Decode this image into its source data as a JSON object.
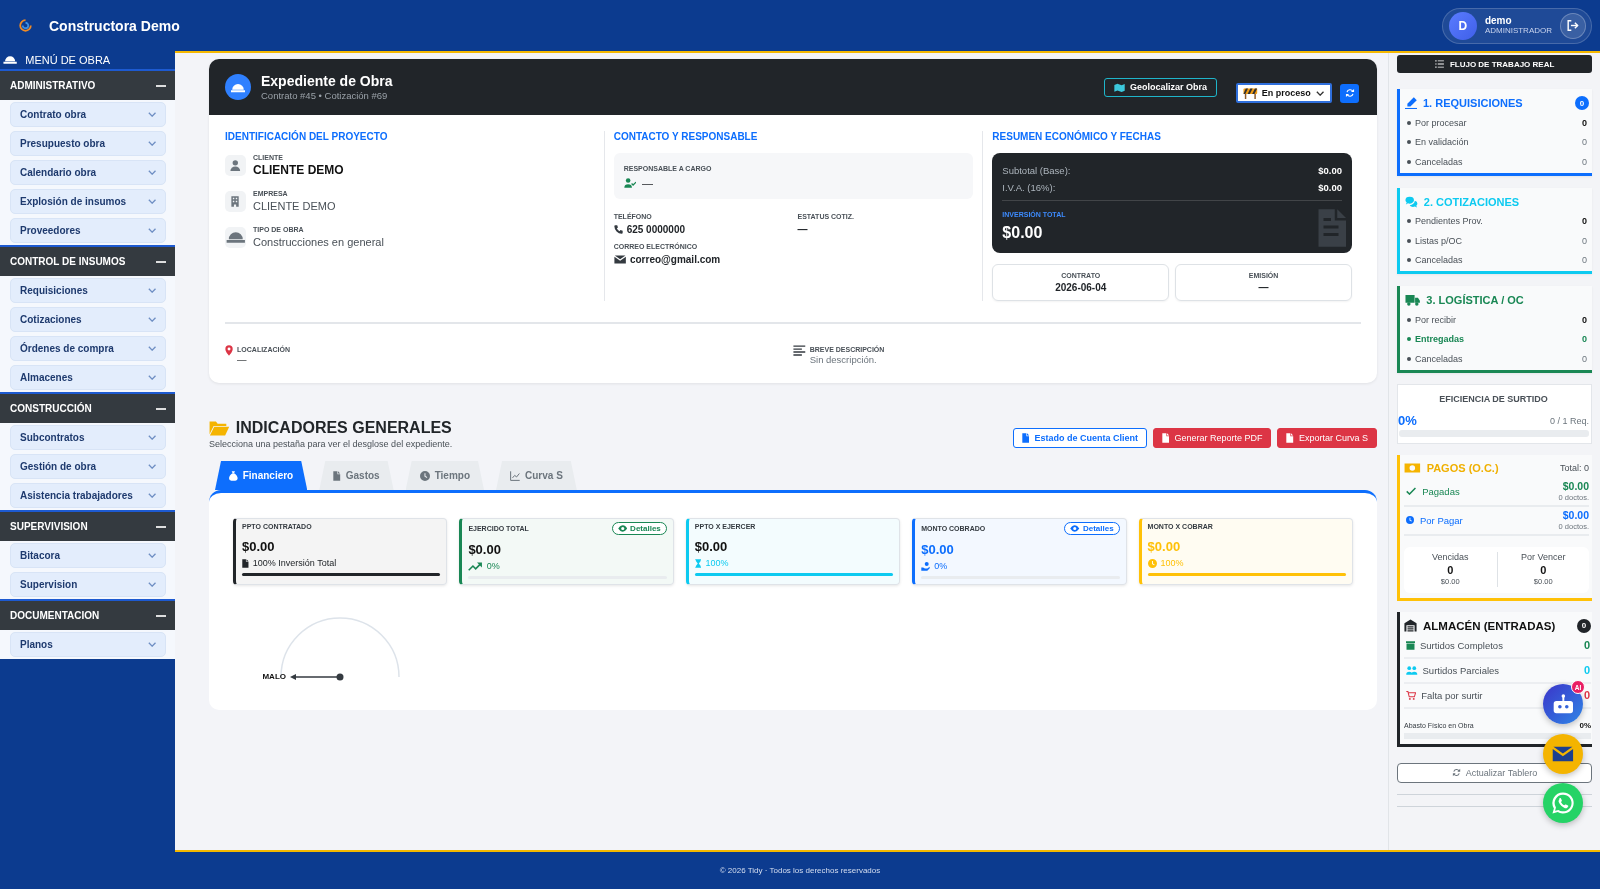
{
  "header": {
    "brand": "Constructora Demo",
    "user": {
      "initial": "D",
      "name": "demo",
      "role": "ADMINISTRADOR"
    }
  },
  "sidebar": {
    "title": "MENÚ DE OBRA",
    "sections": [
      {
        "title": "ADMINISTRATIVO",
        "expanded": true,
        "items": [
          "Contrato obra",
          "Presupuesto obra",
          "Calendario obra",
          "Explosión de insumos",
          "Proveedores"
        ]
      },
      {
        "title": "CONTROL DE INSUMOS",
        "expanded": true,
        "items": [
          "Requisiciones",
          "Cotizaciones",
          "Órdenes de compra",
          "Almacenes"
        ]
      },
      {
        "title": "CONSTRUCCIÓN",
        "expanded": true,
        "items": [
          "Subcontratos",
          "Gestión de obra",
          "Asistencia trabajadores"
        ]
      },
      {
        "title": "SUPERVIVISION",
        "expanded": true,
        "items": [
          "Bitacora",
          "Supervision"
        ]
      },
      {
        "title": "DOCUMENTACION",
        "expanded": true,
        "items": [
          "Planos"
        ]
      }
    ]
  },
  "record": {
    "title": "Expediente de Obra",
    "subtitle": "Contrato #45 • Cotización #69",
    "geolocate_button": "Geolocalizar Obra",
    "status": {
      "value": "En proceso"
    },
    "identification": {
      "heading": "IDENTIFICACIÓN DEL PROYECTO",
      "fields": [
        {
          "kind": "client",
          "label": "CLIENTE",
          "value": "CLIENTE DEMO"
        },
        {
          "kind": "company",
          "label": "EMPRESA",
          "value": "CLIENTE DEMO"
        },
        {
          "kind": "work_type",
          "label": "TIPO DE OBRA",
          "value": "Construcciones en general"
        }
      ]
    },
    "contact": {
      "heading": "CONTACTO Y RESPONSABLE",
      "responsible": {
        "label": "RESPONSABLE A CARGO",
        "value": "—"
      },
      "fields": [
        {
          "kind": "phone",
          "label": "TELÉFONO",
          "value": "625 0000000"
        },
        {
          "kind": "plain",
          "label": "ESTATUS COTIZ.",
          "value": "—"
        },
        {
          "kind": "email",
          "label": "CORREO ELECTRÓNICO",
          "value": "correo@gmail.com"
        }
      ]
    },
    "summary": {
      "heading": "RESUMEN ECONÓMICO Y FECHAS",
      "lines": [
        {
          "label": "Subtotal (Base):",
          "value": "$0.00"
        },
        {
          "label": "I.V.A. (16%):",
          "value": "$0.00"
        }
      ],
      "total": {
        "label": "INVERSIÓN TOTAL",
        "value": "$0.00"
      },
      "dates": [
        {
          "label": "CONTRATO",
          "value": "2026-06-04"
        },
        {
          "label": "EMISIÓN",
          "value": "—"
        }
      ]
    },
    "details": [
      {
        "kind": "location",
        "label": "LOCALIZACIÓN",
        "value": "—"
      },
      {
        "kind": "description",
        "label": "BREVE DESCRIPCIÓN",
        "value": "Sin descripción."
      }
    ]
  },
  "indicators": {
    "title": "INDICADORES GENERALES",
    "subtitle": "Selecciona una pestaña para ver el desglose del expediente.",
    "actions": [
      {
        "kind": "outline",
        "label": "Estado de Cuenta Client"
      },
      {
        "kind": "danger",
        "label": "Generar Reporte PDF"
      },
      {
        "kind": "danger",
        "label": "Exportar Curva S"
      }
    ],
    "tabs": [
      {
        "kind": "money",
        "label": "Financiero",
        "selected": true
      },
      {
        "kind": "expenses",
        "label": "Gastos",
        "selected": false
      },
      {
        "kind": "time",
        "label": "Tiempo",
        "selected": false
      },
      {
        "kind": "curve",
        "label": "Curva S",
        "selected": false
      }
    ],
    "kpis": [
      {
        "kind": "document",
        "label": "PPTO CONTRATADO",
        "value": "$0.00",
        "note": "100% Inversión Total",
        "level": 1,
        "color": "#212529",
        "tinted_value": false
      },
      {
        "kind": "trend",
        "label": "EJERCIDO TOTAL",
        "value": "$0.00",
        "note": "0%",
        "level": 0,
        "color": "#198754",
        "tinted_value": false,
        "details_button": "Detalles"
      },
      {
        "kind": "hourglass",
        "label": "PPTO X EJERCER",
        "value": "$0.00",
        "note": "100%",
        "level": 1,
        "color": "#0dcaf0",
        "tinted_value": false
      },
      {
        "kind": "collected",
        "label": "MONTO COBRADO",
        "value": "$0.00",
        "note": "0%",
        "level": 0,
        "color": "#0d6efd",
        "tinted_value": true,
        "details_button": "Detalles"
      },
      {
        "kind": "pending",
        "label": "MONTO X COBRAR",
        "value": "$0.00",
        "note": "100%",
        "level": 1,
        "color": "#ffc107",
        "tinted_value": true
      }
    ],
    "gauge": {
      "label": "MALO"
    }
  },
  "workflow": {
    "title": "FLUJO DE TRABAJO REAL",
    "stages": [
      {
        "kind": "requisitions",
        "title": "1. REQUISICIONES",
        "color": "#0d6efd",
        "badge": "0",
        "rows": [
          {
            "kind": "strong",
            "label": "Por procesar",
            "value": "0"
          },
          {
            "kind": "muted",
            "label": "En validación",
            "value": "0"
          },
          {
            "kind": "muted",
            "label": "Canceladas",
            "value": "0"
          }
        ]
      },
      {
        "kind": "quotes",
        "title": "2. COTIZACIONES",
        "color": "#0dcaf0",
        "rows": [
          {
            "kind": "strong",
            "label": "Pendientes Prov.",
            "value": "0"
          },
          {
            "kind": "muted",
            "label": "Listas p/OC",
            "value": "0"
          },
          {
            "kind": "muted",
            "label": "Canceladas",
            "value": "0"
          }
        ]
      },
      {
        "kind": "logistics",
        "title": "3. LOGÍSTICA / OC",
        "color": "#198754",
        "rows": [
          {
            "kind": "strong",
            "label": "Por recibir",
            "value": "0"
          },
          {
            "kind": "success",
            "label": "Entregadas",
            "value": "0"
          },
          {
            "kind": "muted",
            "label": "Canceladas",
            "value": "0"
          }
        ]
      }
    ],
    "efficiency": {
      "title": "EFICIENCIA DE SURTIDO",
      "value": "0%",
      "count": "0 / 1 Req.",
      "level": 0
    },
    "payments": {
      "title": "PAGOS (O.C.)",
      "total": "Total: 0",
      "rows": [
        {
          "kind": "paid",
          "label": "Pagadas",
          "amount": "$0.00",
          "docs": "0 doctos."
        },
        {
          "kind": "due",
          "label": "Por Pagar",
          "amount": "$0.00",
          "docs": "0 doctos."
        }
      ],
      "buckets": [
        {
          "label": "Vencidas",
          "count": "0",
          "amount": "$0.00"
        },
        {
          "label": "Por Vencer",
          "count": "0",
          "amount": "$0.00"
        }
      ]
    },
    "warehouse": {
      "title": "ALMACÉN (ENTRADAS)",
      "badge": "0",
      "rows": [
        {
          "kind": "complete",
          "label": "Surtidos Completos",
          "value": "0"
        },
        {
          "kind": "partial",
          "label": "Surtidos Parciales",
          "value": "0"
        },
        {
          "kind": "missing",
          "label": "Falta por surtir",
          "value": "0"
        }
      ],
      "supply": {
        "label": "Abasto Físico en Obra",
        "value": "0%",
        "level": 0
      }
    },
    "refresh_button": "Actualizar Tablero"
  },
  "floating_buttons": [
    {
      "kind": "assistant",
      "badge": "AI"
    },
    {
      "kind": "email"
    },
    {
      "kind": "chat"
    }
  ],
  "footer": "© 2026 Tidy · Todos los derechos reservados"
}
